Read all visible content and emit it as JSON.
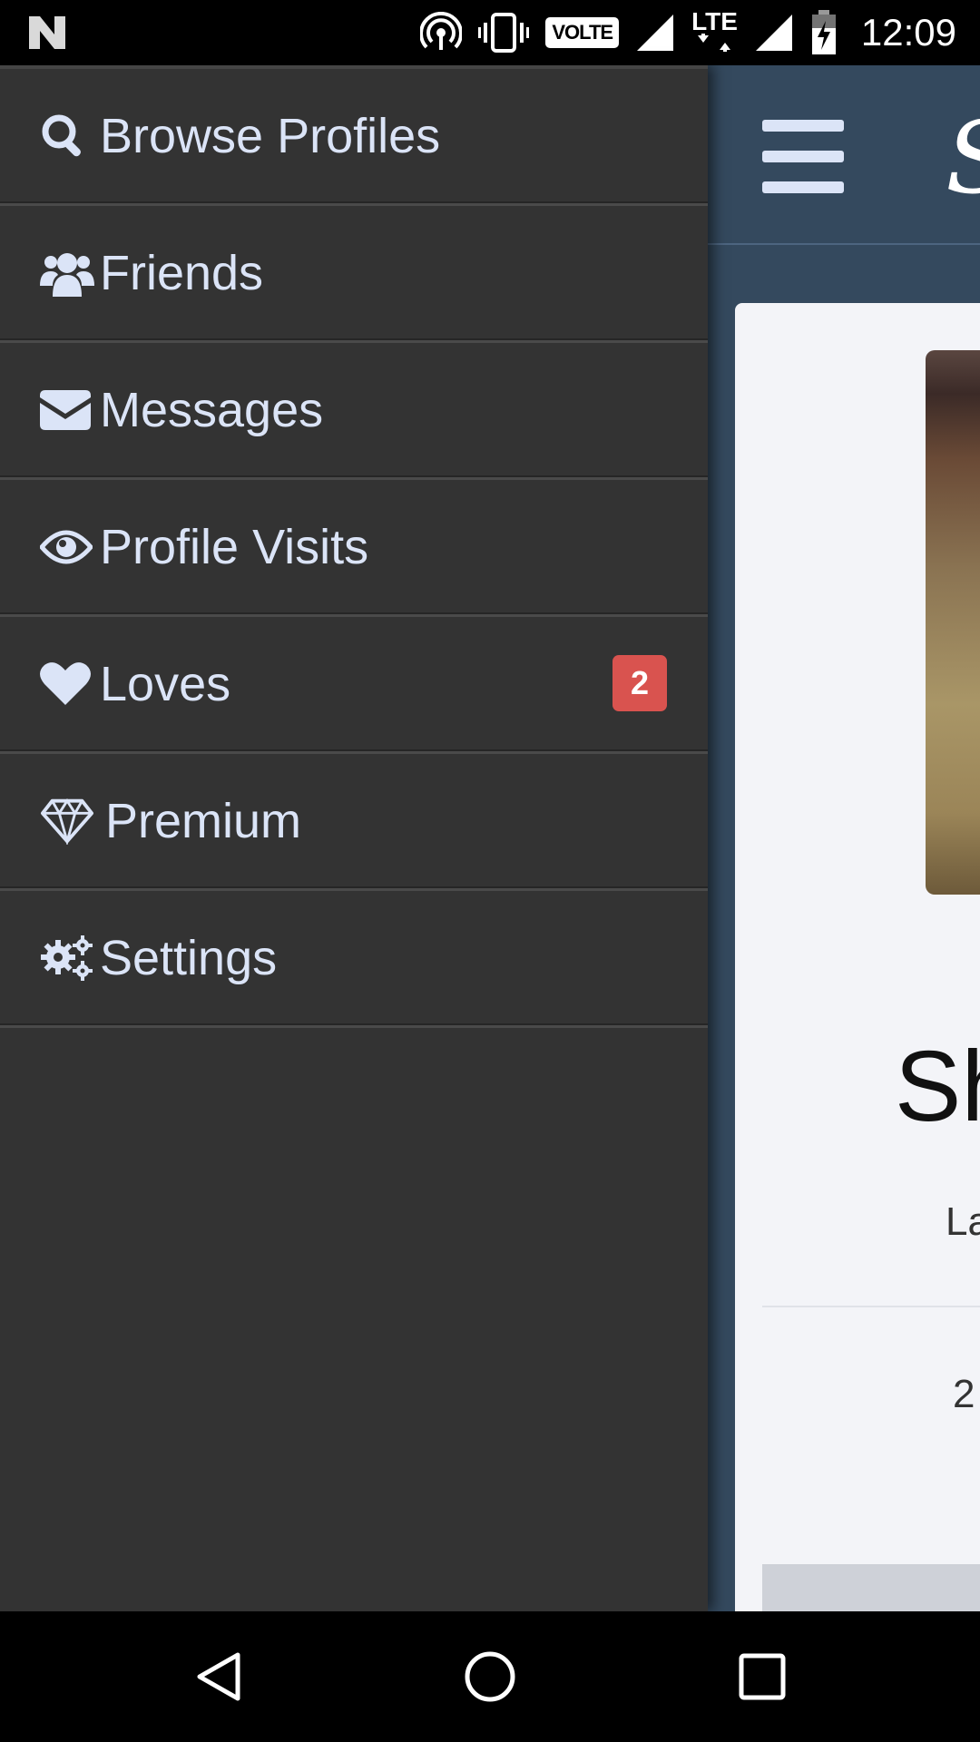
{
  "status_bar": {
    "time": "12:09",
    "network_label": "LTE",
    "volte_label": "VOLTE"
  },
  "drawer": {
    "items": [
      {
        "label": "Browse Profiles",
        "icon": "search-icon"
      },
      {
        "label": "Friends",
        "icon": "users-icon"
      },
      {
        "label": "Messages",
        "icon": "envelope-icon"
      },
      {
        "label": "Profile Visits",
        "icon": "eye-icon"
      },
      {
        "label": "Loves",
        "icon": "heart-icon",
        "badge": "2"
      },
      {
        "label": "Premium",
        "icon": "diamond-icon"
      },
      {
        "label": "Settings",
        "icon": "gears-icon"
      }
    ],
    "colors": {
      "background": "#333333",
      "text": "#dbe4f7",
      "badge": "#d9534f"
    }
  },
  "main": {
    "brand_fragment": "S",
    "name_fragment": "Sh",
    "subtitle_fragment": "La",
    "number_fragment": "2",
    "colors": {
      "header": "#34495e",
      "card": "#f3f4f8"
    }
  }
}
